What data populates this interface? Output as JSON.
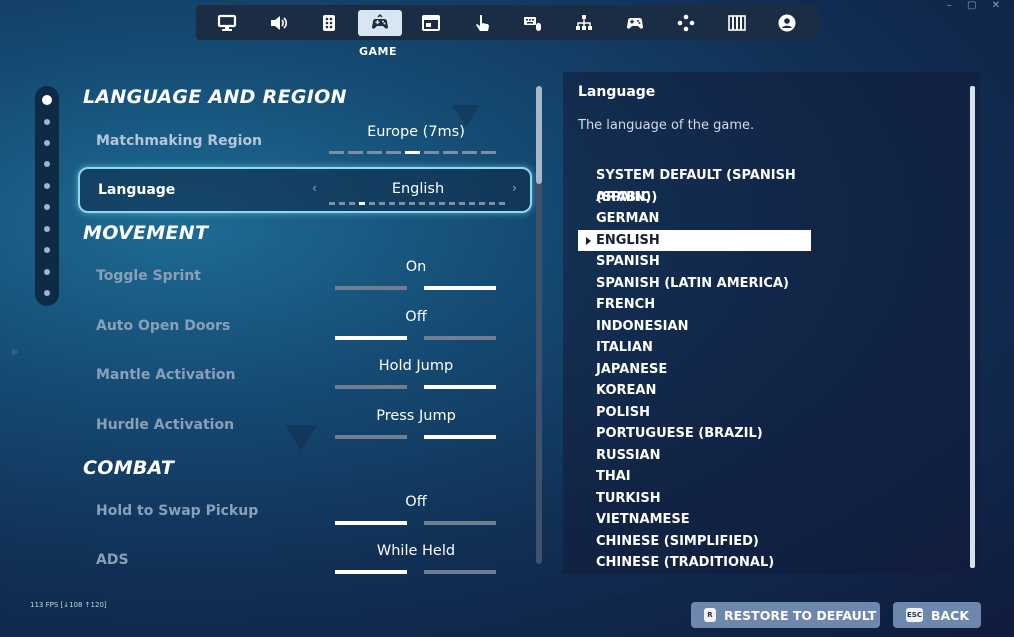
{
  "window_controls": "–  ▢  ✕",
  "nav": {
    "tabs": [
      {
        "icon": "monitor-icon"
      },
      {
        "icon": "speaker-icon"
      },
      {
        "icon": "accessibility-icon"
      },
      {
        "icon": "game-icon",
        "active": true
      },
      {
        "icon": "window-icon"
      },
      {
        "icon": "touch-icon"
      },
      {
        "icon": "keyboard-mouse-icon"
      },
      {
        "icon": "network-icon"
      },
      {
        "icon": "gamepad-icon"
      },
      {
        "icon": "dpad-icon"
      },
      {
        "icon": "piano-icon"
      },
      {
        "icon": "account-icon"
      }
    ],
    "active_caption": "GAME"
  },
  "sections": {
    "language_region": "LANGUAGE AND REGION",
    "movement": "MOVEMENT",
    "combat": "COMBAT"
  },
  "settings": {
    "matchmaking": {
      "label": "Matchmaking Region",
      "value": "Europe (7ms)",
      "option_count": 9,
      "selected_index": 4
    },
    "language": {
      "label": "Language",
      "value": "English",
      "option_count": 18,
      "selected_index": 3,
      "prev": "‹",
      "next": "›"
    },
    "toggle_sprint": {
      "label": "Toggle Sprint",
      "value": "On",
      "selected_index": 1
    },
    "auto_open_doors": {
      "label": "Auto Open Doors",
      "value": "Off",
      "selected_index": 0
    },
    "mantle_activation": {
      "label": "Mantle Activation",
      "value": "Hold Jump",
      "selected_index": 1
    },
    "hurdle_activation": {
      "label": "Hurdle Activation",
      "value": "Press Jump",
      "selected_index": 1
    },
    "hold_to_swap": {
      "label": "Hold to Swap Pickup",
      "value": "Off",
      "selected_index": 0
    },
    "ads": {
      "label": "ADS",
      "value": "While Held",
      "selected_index": 0
    }
  },
  "detail": {
    "title": "Language",
    "description": "The language of the game.",
    "languages": [
      "SYSTEM DEFAULT (SPANISH (SPAIN))",
      "ARABIC",
      "GERMAN",
      "ENGLISH",
      "SPANISH",
      "SPANISH (LATIN AMERICA)",
      "FRENCH",
      "INDONESIAN",
      "ITALIAN",
      "JAPANESE",
      "KOREAN",
      "POLISH",
      "PORTUGUESE (BRAZIL)",
      "RUSSIAN",
      "THAI",
      "TURKISH",
      "VIETNAMESE",
      "CHINESE (SIMPLIFIED)",
      "CHINESE (TRADITIONAL)"
    ],
    "selected_language": "ENGLISH"
  },
  "footer": {
    "fps": "113 FPS [↓108 ↑120]",
    "restore_key": "R",
    "restore_label": "RESTORE TO DEFAULT",
    "back_key": "ESC",
    "back_label": "BACK"
  }
}
